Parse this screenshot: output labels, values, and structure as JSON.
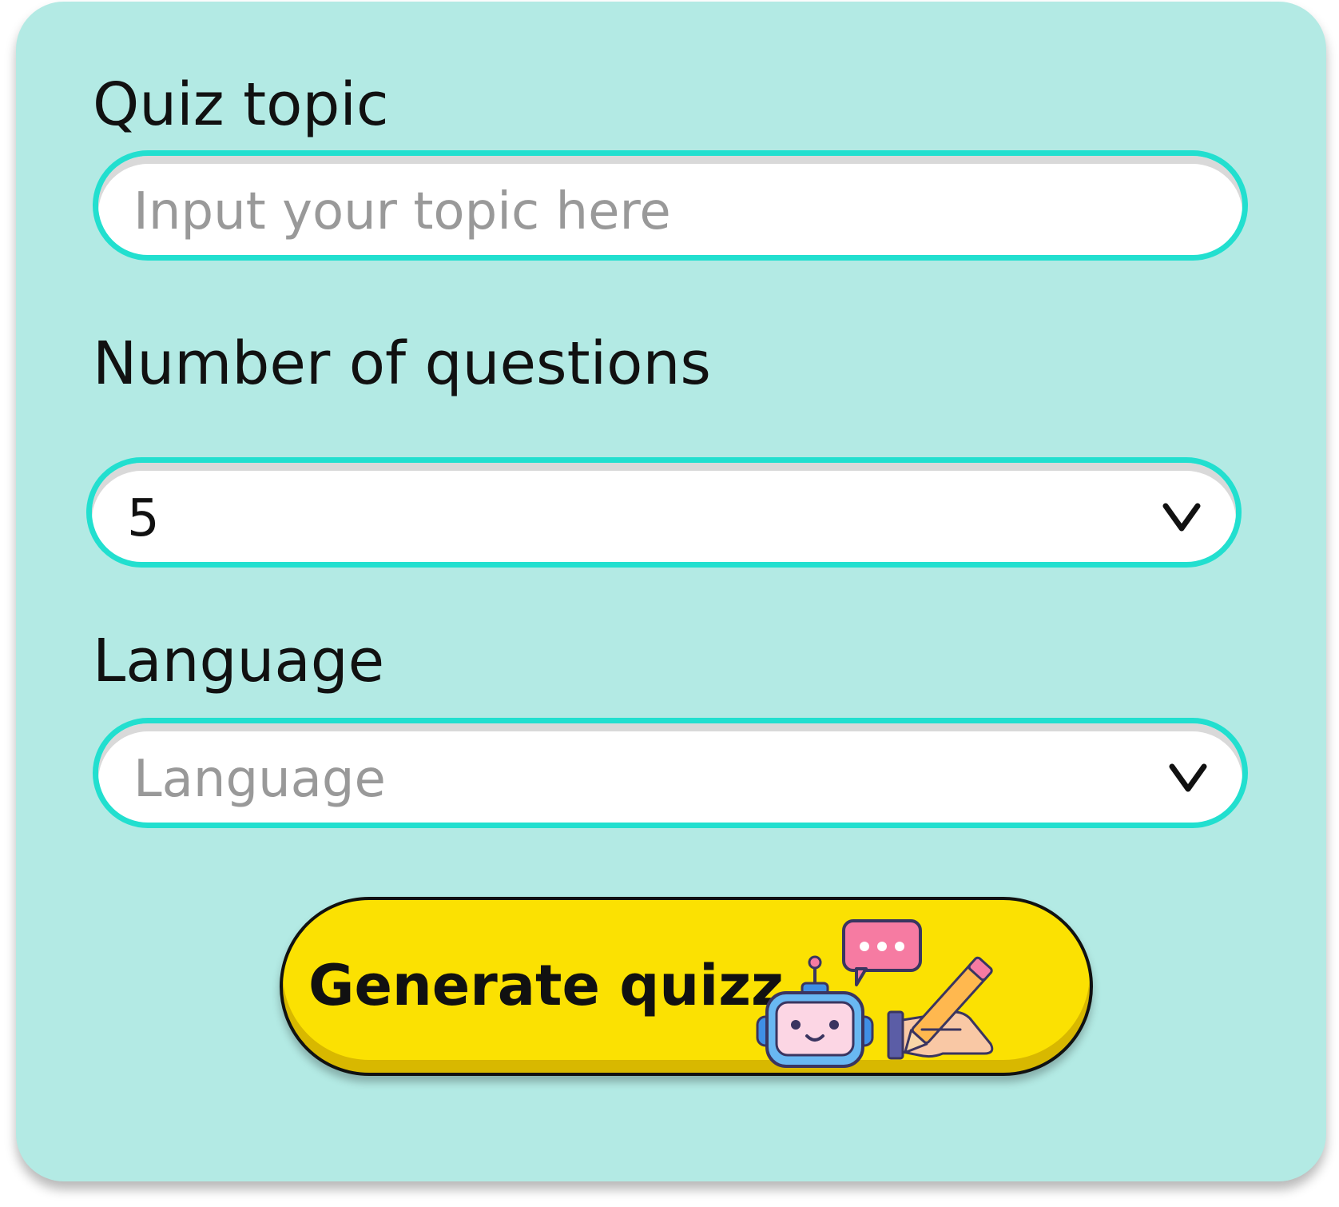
{
  "form": {
    "topic": {
      "label": "Quiz topic",
      "placeholder": "Input your topic here",
      "value": ""
    },
    "questions": {
      "label": "Number of questions",
      "selected": "5"
    },
    "language": {
      "label": "Language",
      "placeholder": "Language"
    },
    "submit": {
      "label": "Generate quizz"
    }
  },
  "colors": {
    "card_bg": "#b3eae4",
    "field_border": "#22dfcf",
    "button_bg": "#fbe102",
    "placeholder_text": "#999999"
  },
  "icons": {
    "select_arrow": "chevron-down-icon",
    "button_illustration": "robot-writing-icon"
  }
}
